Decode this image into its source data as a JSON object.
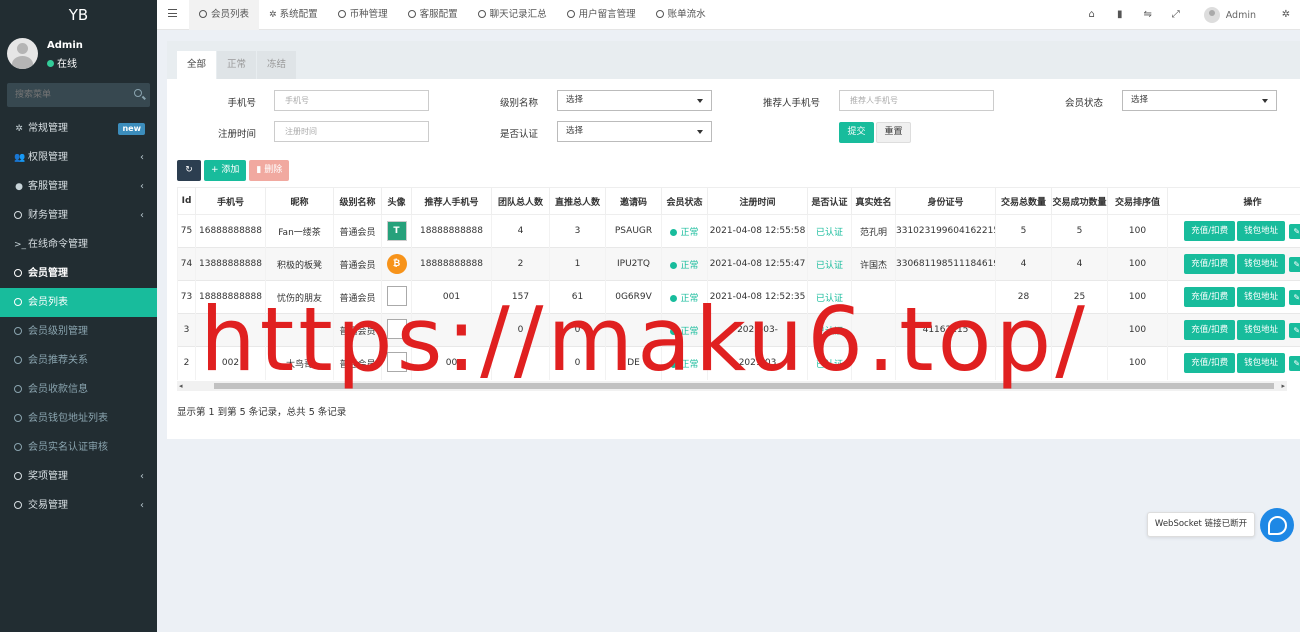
{
  "sidebar": {
    "logo": "YB",
    "user": {
      "name": "Admin",
      "status": "在线"
    },
    "search_placeholder": "搜索菜单",
    "items": [
      {
        "label": "常规管理",
        "icon": "gears-icon",
        "badge": "new"
      },
      {
        "label": "权限管理",
        "icon": "users-icon",
        "chevron": "‹"
      },
      {
        "label": "客服管理",
        "icon": "comment-icon",
        "chevron": "‹"
      },
      {
        "label": "财务管理",
        "icon": "circle-icon",
        "chevron": "‹"
      },
      {
        "label": "在线命令管理",
        "icon": "terminal-icon"
      },
      {
        "label": "会员管理",
        "icon": "circle-icon"
      },
      {
        "label": "会员列表",
        "icon": "circle-icon"
      },
      {
        "label": "会员级别管理",
        "icon": "circle-icon"
      },
      {
        "label": "会员推荐关系",
        "icon": "circle-icon"
      },
      {
        "label": "会员收款信息",
        "icon": "circle-icon"
      },
      {
        "label": "会员钱包地址列表",
        "icon": "circle-icon"
      },
      {
        "label": "会员实名认证审核",
        "icon": "circle-icon"
      },
      {
        "label": "奖项管理",
        "icon": "circle-icon",
        "chevron": "‹"
      },
      {
        "label": "交易管理",
        "icon": "circle-icon",
        "chevron": "‹"
      }
    ]
  },
  "topbar": {
    "tabs": [
      "会员列表",
      "系统配置",
      "币种管理",
      "客服配置",
      "聊天记录汇总",
      "用户留言管理",
      "账单流水"
    ],
    "user": "Admin"
  },
  "panel_tabs": [
    "全部",
    "正常",
    "冻结"
  ],
  "filters": {
    "phone": {
      "label": "手机号",
      "placeholder": "手机号"
    },
    "level": {
      "label": "级别名称",
      "value": "选择"
    },
    "referrer": {
      "label": "推荐人手机号",
      "placeholder": "推荐人手机号"
    },
    "status": {
      "label": "会员状态",
      "value": "选择"
    },
    "regtime": {
      "label": "注册时间",
      "placeholder": "注册时间"
    },
    "verified": {
      "label": "是否认证",
      "value": "选择"
    },
    "submit": "提交",
    "reset": "重置"
  },
  "toolbar": {
    "add": "添加",
    "delete": "删除"
  },
  "table": {
    "headers": [
      "Id",
      "手机号",
      "昵称",
      "级别名称",
      "头像",
      "推荐人手机号",
      "团队总人数",
      "直推总人数",
      "邀请码",
      "会员状态",
      "注册时间",
      "是否认证",
      "真实姓名",
      "身份证号",
      "交易总数量",
      "交易成功数量",
      "交易排序值",
      "操作"
    ],
    "rows": [
      {
        "id": "75",
        "phone": "16888888888",
        "nick": "Fan一缕茶",
        "level": "普通会员",
        "avatar": "T",
        "ref": "18888888888",
        "team": "4",
        "direct": "3",
        "code": "PSAUGR",
        "status": "正常",
        "reg": "2021-04-08 12:55:58",
        "verified": "已认证",
        "real": "范孔明",
        "idno": "331023199604162215",
        "total": "5",
        "success": "5",
        "sort": "100"
      },
      {
        "id": "74",
        "phone": "13888888888",
        "nick": "积极的板凳",
        "level": "普通会员",
        "avatar": "₿",
        "ref": "18888888888",
        "team": "2",
        "direct": "1",
        "code": "IPU2TQ",
        "status": "正常",
        "reg": "2021-04-08 12:55:47",
        "verified": "已认证",
        "real": "许国杰",
        "idno": "330681198511184619",
        "total": "4",
        "success": "4",
        "sort": "100"
      },
      {
        "id": "73",
        "phone": "18888888888",
        "nick": "忧伤的朋友",
        "level": "普通会员",
        "avatar": "",
        "ref": "001",
        "team": "157",
        "direct": "61",
        "code": "0G6R9V",
        "status": "正常",
        "reg": "2021-04-08 12:52:35",
        "verified": "已认证",
        "real": "",
        "idno": "",
        "total": "28",
        "success": "25",
        "sort": "100"
      },
      {
        "id": "3",
        "phone": "",
        "nick": "",
        "level": "普通会员",
        "avatar": "",
        "ref": "",
        "team": "0",
        "direct": "0",
        "code": "",
        "status": "正常",
        "reg": "2021-03-",
        "verified": "已认证",
        "real": "",
        "idno": "41162115",
        "total": "",
        "success": "",
        "sort": "100"
      },
      {
        "id": "2",
        "phone": "002",
        "nick": "大鸟哥",
        "level": "普通会员",
        "avatar": "",
        "ref": "00",
        "team": "",
        "direct": "0",
        "code": "DE",
        "status": "正常",
        "reg": "2021-03",
        "verified": "已认证",
        "real": "",
        "idno": "",
        "total": "",
        "success": "",
        "sort": "100"
      }
    ],
    "op_recharge": "充值/扣费",
    "op_wallet": "钱包地址"
  },
  "page_info": "显示第 1 到第 5 条记录，总共 5 条记录",
  "ws_tip": "WebSocket 链接已断开",
  "watermark": "https://maku6.top/"
}
